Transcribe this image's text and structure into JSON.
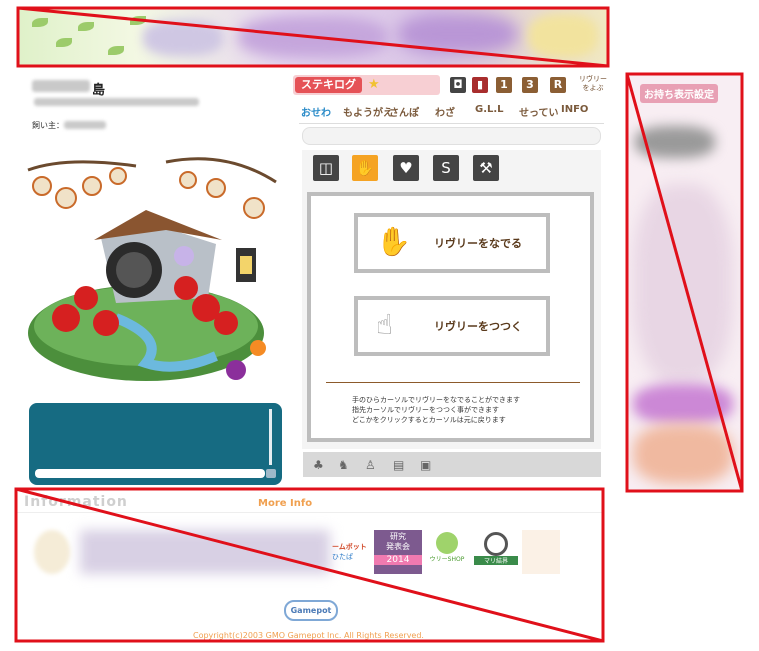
{
  "island": {
    "name_suffix": "島",
    "owner_label": "飼い主："
  },
  "stekilog": {
    "label": "ステキログ",
    "star_icon": "star-icon"
  },
  "top_icons": [
    "camera-icon",
    "book-icon",
    "calendar-1-icon",
    "calendar-3-icon",
    "r-icon"
  ],
  "call_riviera": "リヴリーをよぶ",
  "tabs": [
    "おせわ",
    "もようがえ",
    "さんぽ",
    "わざ",
    "G.L.L",
    "せってい",
    "INFO"
  ],
  "action_icons": [
    "food-icon",
    "hand-icon",
    "heart-icon",
    "swan-icon",
    "tool-icon"
  ],
  "buttons": {
    "pet": "リヴリーをなでる",
    "poke": "リヴリーをつつく"
  },
  "instructions": [
    "手のひらカーソルでリヴリーをなでることができます",
    "指先カーソルでリヴリーをつつく事ができます",
    "どこかをクリックするとカーソルは元に戻ります"
  ],
  "bottom_icons": [
    "plant-icon",
    "animal-icon",
    "clothes-icon",
    "book-icon",
    "box-icon"
  ],
  "info": {
    "title": "Information",
    "more": "More Info",
    "banner_game": "ームポット",
    "banner_game_sub": "ひたぱ",
    "research": "研究\n発表会",
    "research_year": "2014",
    "shop": "ウリーSHOP",
    "ring": "マリ結界",
    "gamepot": "Gamepot",
    "copyright": "Copyright(c)2003 GMO Gamepot Inc. All Rights Reserved."
  },
  "right_panel": {
    "title": "お持ち表示設定"
  },
  "colors": {
    "accent_blue": "#2a8bc8",
    "brand_brown": "#7b5a3c",
    "stekilog_red": "#e55257",
    "chat_teal": "#166b82",
    "active_orange": "#f5a323",
    "redaction_red": "#e0101a"
  }
}
